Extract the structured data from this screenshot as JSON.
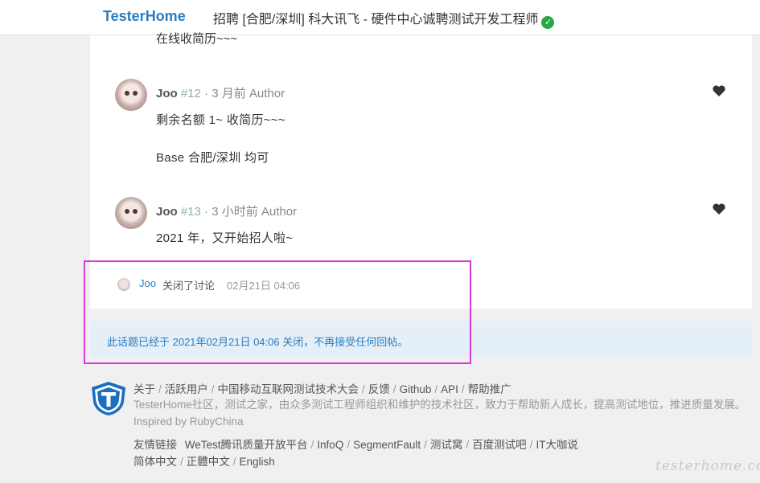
{
  "header": {
    "brand": "TesterHome",
    "topic_title": "招聘 [合肥/深圳] 科大讯飞 - 硬件中心诚聘测试开发工程师",
    "verified_icon": "check-circle-icon"
  },
  "replies": {
    "cut_text": "在线收简历~~~",
    "items": [
      {
        "user": "Joo",
        "floor": "#12",
        "time": "· 3 月前",
        "role": "Author",
        "lines": [
          "剩余名额 1~ 收简历~~~",
          "Base 合肥/深圳 均可"
        ]
      },
      {
        "user": "Joo",
        "floor": "#13",
        "time": "· 3 小时前",
        "role": "Author",
        "lines": [
          "2021 年，又开始招人啦~"
        ]
      }
    ]
  },
  "event": {
    "user": "Joo",
    "action": "关闭了讨论",
    "time": "02月21日 04:06"
  },
  "notice": "此话题已经于 2021年02月21日 04:06 关闭，不再接受任何回帖。",
  "footer": {
    "links": [
      "关于",
      "活跃用户",
      "中国移动互联网测试技术大会",
      "反馈",
      "Github",
      "API",
      "帮助推广"
    ],
    "link_sep": "/",
    "description": "TesterHome社区，测试之家，由众多测试工程师组织和维护的技术社区，致力于帮助新人成长，提高测试地位，推进质量发展。Inspired by RubyChina",
    "friends_label": "友情链接",
    "friends": [
      "WeTest腾讯质量开放平台",
      "InfoQ",
      "SegmentFault",
      "测试窝",
      "百度测试吧",
      "IT大咖说"
    ],
    "languages": [
      "简体中文",
      "正體中文",
      "English"
    ]
  },
  "watermark": "testerhome.com",
  "colors": {
    "brand": "#2a7dc0",
    "highlight": "#d83ad8",
    "notice_bg": "#e4eff8"
  }
}
